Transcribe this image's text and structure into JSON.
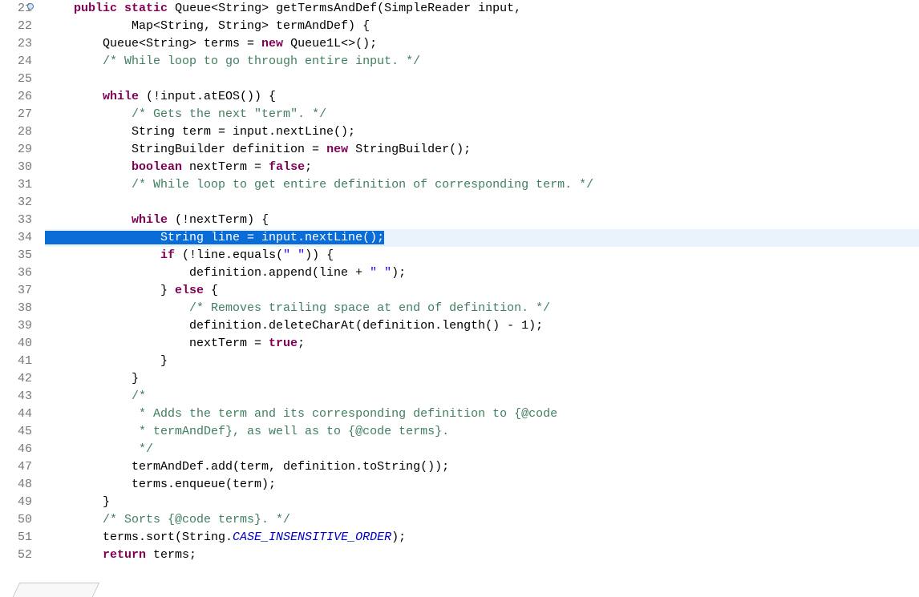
{
  "editor": {
    "first_line": 21,
    "highlighted_line": 34,
    "lines": [
      {
        "num": 21,
        "marker": true,
        "tokens": [
          {
            "cls": "txt",
            "t": "    "
          },
          {
            "cls": "kw",
            "t": "public"
          },
          {
            "cls": "txt",
            "t": " "
          },
          {
            "cls": "kw",
            "t": "static"
          },
          {
            "cls": "txt",
            "t": " Queue<String> getTermsAndDef(SimpleReader input,"
          }
        ]
      },
      {
        "num": 22,
        "tokens": [
          {
            "cls": "txt",
            "t": "            Map<String, String> termAndDef) {"
          }
        ]
      },
      {
        "num": 23,
        "tokens": [
          {
            "cls": "txt",
            "t": "        Queue<String> terms = "
          },
          {
            "cls": "kw",
            "t": "new"
          },
          {
            "cls": "txt",
            "t": " Queue1L<>();"
          }
        ]
      },
      {
        "num": 24,
        "tokens": [
          {
            "cls": "txt",
            "t": "        "
          },
          {
            "cls": "cm",
            "t": "/* While loop to go through entire input. */"
          }
        ]
      },
      {
        "num": 25,
        "tokens": []
      },
      {
        "num": 26,
        "tokens": [
          {
            "cls": "txt",
            "t": "        "
          },
          {
            "cls": "kw",
            "t": "while"
          },
          {
            "cls": "txt",
            "t": " (!input.atEOS()) {"
          }
        ]
      },
      {
        "num": 27,
        "tokens": [
          {
            "cls": "txt",
            "t": "            "
          },
          {
            "cls": "cm",
            "t": "/* Gets the next \"term\". */"
          }
        ]
      },
      {
        "num": 28,
        "tokens": [
          {
            "cls": "txt",
            "t": "            String term = input.nextLine();"
          }
        ]
      },
      {
        "num": 29,
        "tokens": [
          {
            "cls": "txt",
            "t": "            StringBuilder definition = "
          },
          {
            "cls": "kw",
            "t": "new"
          },
          {
            "cls": "txt",
            "t": " StringBuilder();"
          }
        ]
      },
      {
        "num": 30,
        "tokens": [
          {
            "cls": "txt",
            "t": "            "
          },
          {
            "cls": "kw",
            "t": "boolean"
          },
          {
            "cls": "txt",
            "t": " nextTerm = "
          },
          {
            "cls": "kw",
            "t": "false"
          },
          {
            "cls": "txt",
            "t": ";"
          }
        ]
      },
      {
        "num": 31,
        "tokens": [
          {
            "cls": "txt",
            "t": "            "
          },
          {
            "cls": "cm",
            "t": "/* While loop to get entire definition of corresponding term. */"
          }
        ]
      },
      {
        "num": 32,
        "tokens": []
      },
      {
        "num": 33,
        "tokens": [
          {
            "cls": "txt",
            "t": "            "
          },
          {
            "cls": "kw",
            "t": "while"
          },
          {
            "cls": "txt",
            "t": " (!nextTerm) {"
          }
        ]
      },
      {
        "num": 34,
        "highlight": true,
        "tokens": [
          {
            "cls": "sel",
            "t": "                String line = input.nextLine();"
          }
        ]
      },
      {
        "num": 35,
        "tokens": [
          {
            "cls": "txt",
            "t": "                "
          },
          {
            "cls": "kw",
            "t": "if"
          },
          {
            "cls": "txt",
            "t": " (!line.equals("
          },
          {
            "cls": "str",
            "t": "\" \""
          },
          {
            "cls": "txt",
            "t": ")) {"
          }
        ]
      },
      {
        "num": 36,
        "tokens": [
          {
            "cls": "txt",
            "t": "                    definition.append(line + "
          },
          {
            "cls": "str",
            "t": "\" \""
          },
          {
            "cls": "txt",
            "t": ");"
          }
        ]
      },
      {
        "num": 37,
        "tokens": [
          {
            "cls": "txt",
            "t": "                } "
          },
          {
            "cls": "kw",
            "t": "else"
          },
          {
            "cls": "txt",
            "t": " {"
          }
        ]
      },
      {
        "num": 38,
        "tokens": [
          {
            "cls": "txt",
            "t": "                    "
          },
          {
            "cls": "cm",
            "t": "/* Removes trailing space at end of definition. */"
          }
        ]
      },
      {
        "num": 39,
        "tokens": [
          {
            "cls": "txt",
            "t": "                    definition.deleteCharAt(definition.length() - 1);"
          }
        ]
      },
      {
        "num": 40,
        "tokens": [
          {
            "cls": "txt",
            "t": "                    nextTerm = "
          },
          {
            "cls": "kw",
            "t": "true"
          },
          {
            "cls": "txt",
            "t": ";"
          }
        ]
      },
      {
        "num": 41,
        "tokens": [
          {
            "cls": "txt",
            "t": "                }"
          }
        ]
      },
      {
        "num": 42,
        "tokens": [
          {
            "cls": "txt",
            "t": "            }"
          }
        ]
      },
      {
        "num": 43,
        "tokens": [
          {
            "cls": "txt",
            "t": "            "
          },
          {
            "cls": "cm",
            "t": "/*"
          }
        ]
      },
      {
        "num": 44,
        "tokens": [
          {
            "cls": "cm",
            "t": "             * Adds the term and its corresponding definition to {@code"
          }
        ]
      },
      {
        "num": 45,
        "tokens": [
          {
            "cls": "cm",
            "t": "             * termAndDef}, as well as to {@code terms}."
          }
        ]
      },
      {
        "num": 46,
        "tokens": [
          {
            "cls": "cm",
            "t": "             */"
          }
        ]
      },
      {
        "num": 47,
        "tokens": [
          {
            "cls": "txt",
            "t": "            termAndDef.add(term, definition.toString());"
          }
        ]
      },
      {
        "num": 48,
        "tokens": [
          {
            "cls": "txt",
            "t": "            terms.enqueue(term);"
          }
        ]
      },
      {
        "num": 49,
        "tokens": [
          {
            "cls": "txt",
            "t": "        }"
          }
        ]
      },
      {
        "num": 50,
        "tokens": [
          {
            "cls": "txt",
            "t": "        "
          },
          {
            "cls": "cm",
            "t": "/* Sorts {@code terms}. */"
          }
        ]
      },
      {
        "num": 51,
        "tokens": [
          {
            "cls": "txt",
            "t": "        terms.sort(String."
          },
          {
            "cls": "fld",
            "t": "CASE_INSENSITIVE_ORDER"
          },
          {
            "cls": "txt",
            "t": ");"
          }
        ]
      },
      {
        "num": 52,
        "tokens": [
          {
            "cls": "txt",
            "t": "        "
          },
          {
            "cls": "kw",
            "t": "return"
          },
          {
            "cls": "txt",
            "t": " terms;"
          }
        ]
      }
    ]
  }
}
